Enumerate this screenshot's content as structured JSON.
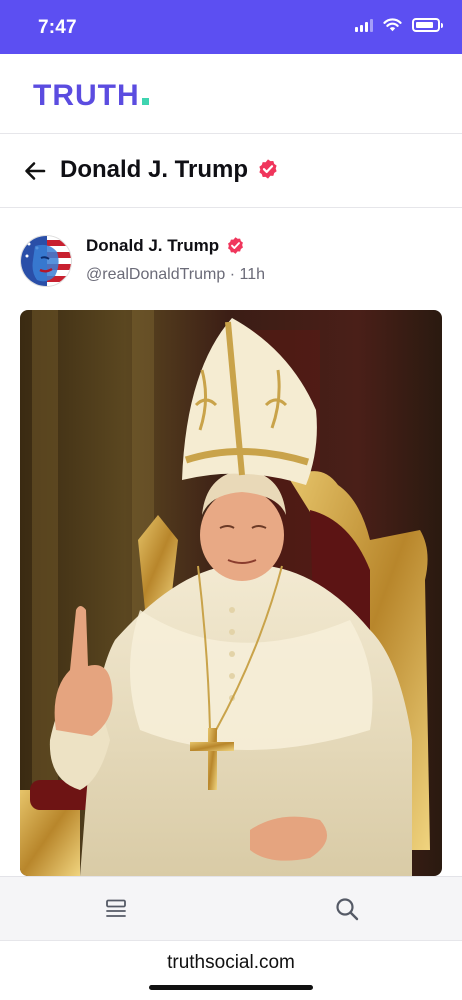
{
  "status_bar": {
    "time": "7:47",
    "icons": [
      "cellular-signal-icon",
      "wifi-icon",
      "battery-icon"
    ]
  },
  "brand": {
    "logo_text": "TRUTH",
    "logo_color": "#5b4ce0",
    "accent_dot_color": "#3fd4b0",
    "status_bar_color": "#5c4ff2"
  },
  "profile_header": {
    "back_icon": "back-arrow-icon",
    "name": "Donald J. Trump",
    "verified_icon": "verified-badge-icon",
    "verified_color": "#f0365c"
  },
  "post": {
    "author_name": "Donald J. Trump",
    "author_handle": "@realDonaldTrump",
    "separator": "·",
    "time_ago": "11h",
    "avatar_icon": "avatar",
    "image_icon": "post-image"
  },
  "bottom_nav": {
    "items": [
      {
        "icon": "feed-icon"
      },
      {
        "icon": "search-icon"
      }
    ]
  },
  "browser": {
    "url": "truthsocial.com"
  }
}
